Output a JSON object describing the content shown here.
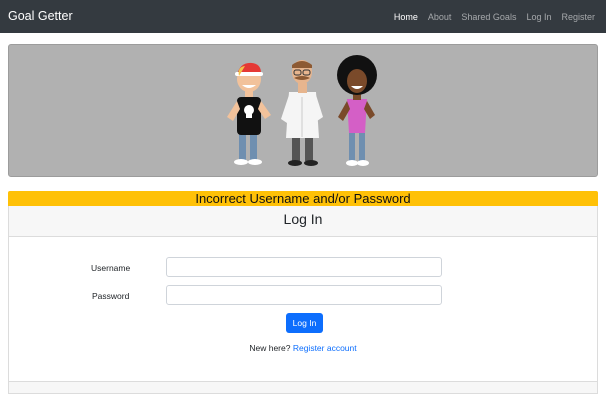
{
  "navbar": {
    "brand": "Goal Getter",
    "links": [
      {
        "label": "Home"
      },
      {
        "label": "About"
      },
      {
        "label": "Shared Goals"
      },
      {
        "label": "Log In"
      },
      {
        "label": "Register"
      }
    ]
  },
  "alert": {
    "message": "Incorrect Username and/or Password"
  },
  "login": {
    "title": "Log In",
    "username_label": "Username",
    "username_value": "",
    "password_label": "Password",
    "password_value": "",
    "submit_label": "Log In",
    "register_prompt": "New here?",
    "register_link": "Register account"
  },
  "colors": {
    "navbar_bg": "#343a40",
    "hero_bg": "#b1b1b1",
    "alert_bg": "#ffc107",
    "primary": "#0d6efd"
  }
}
